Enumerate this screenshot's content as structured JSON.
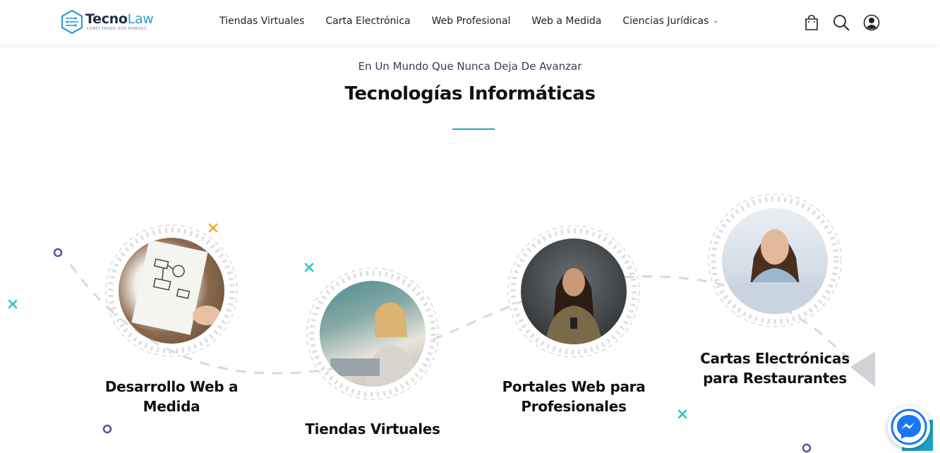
{
  "brand": {
    "name_part1": "Tecno",
    "name_part2": "Law",
    "tagline": "CONECTANDO DOS MUNDOS"
  },
  "nav": {
    "items": [
      {
        "label": "Tiendas Virtuales"
      },
      {
        "label": "Carta Electrónica"
      },
      {
        "label": "Web Profesional"
      },
      {
        "label": "Web a Medida"
      },
      {
        "label": "Ciencias Jurídicas",
        "has_dropdown": true
      }
    ]
  },
  "header_icons": [
    "shopping-bag-icon",
    "search-icon",
    "user-account-icon"
  ],
  "hero": {
    "eyebrow": "En Un Mundo Que Nunca Deja De Avanzar",
    "title": "Tecnologías Informáticas"
  },
  "services": [
    {
      "title_line1": "Desarrollo Web a",
      "title_line2": "Medida"
    },
    {
      "title_line1": "Tiendas Virtuales",
      "title_line2": ""
    },
    {
      "title_line1": "Portales Web para",
      "title_line2": "Profesionales"
    },
    {
      "title_line1": "Cartas Electrónicas",
      "title_line2": "para Restaurantes"
    }
  ],
  "colors": {
    "accent": "#2c9fc7",
    "brand_dark": "#1f2a44",
    "deco_teal": "#27c7c0",
    "deco_orange": "#f5a623",
    "deco_purple": "#5b4e9a",
    "messenger": "#1877f2"
  }
}
